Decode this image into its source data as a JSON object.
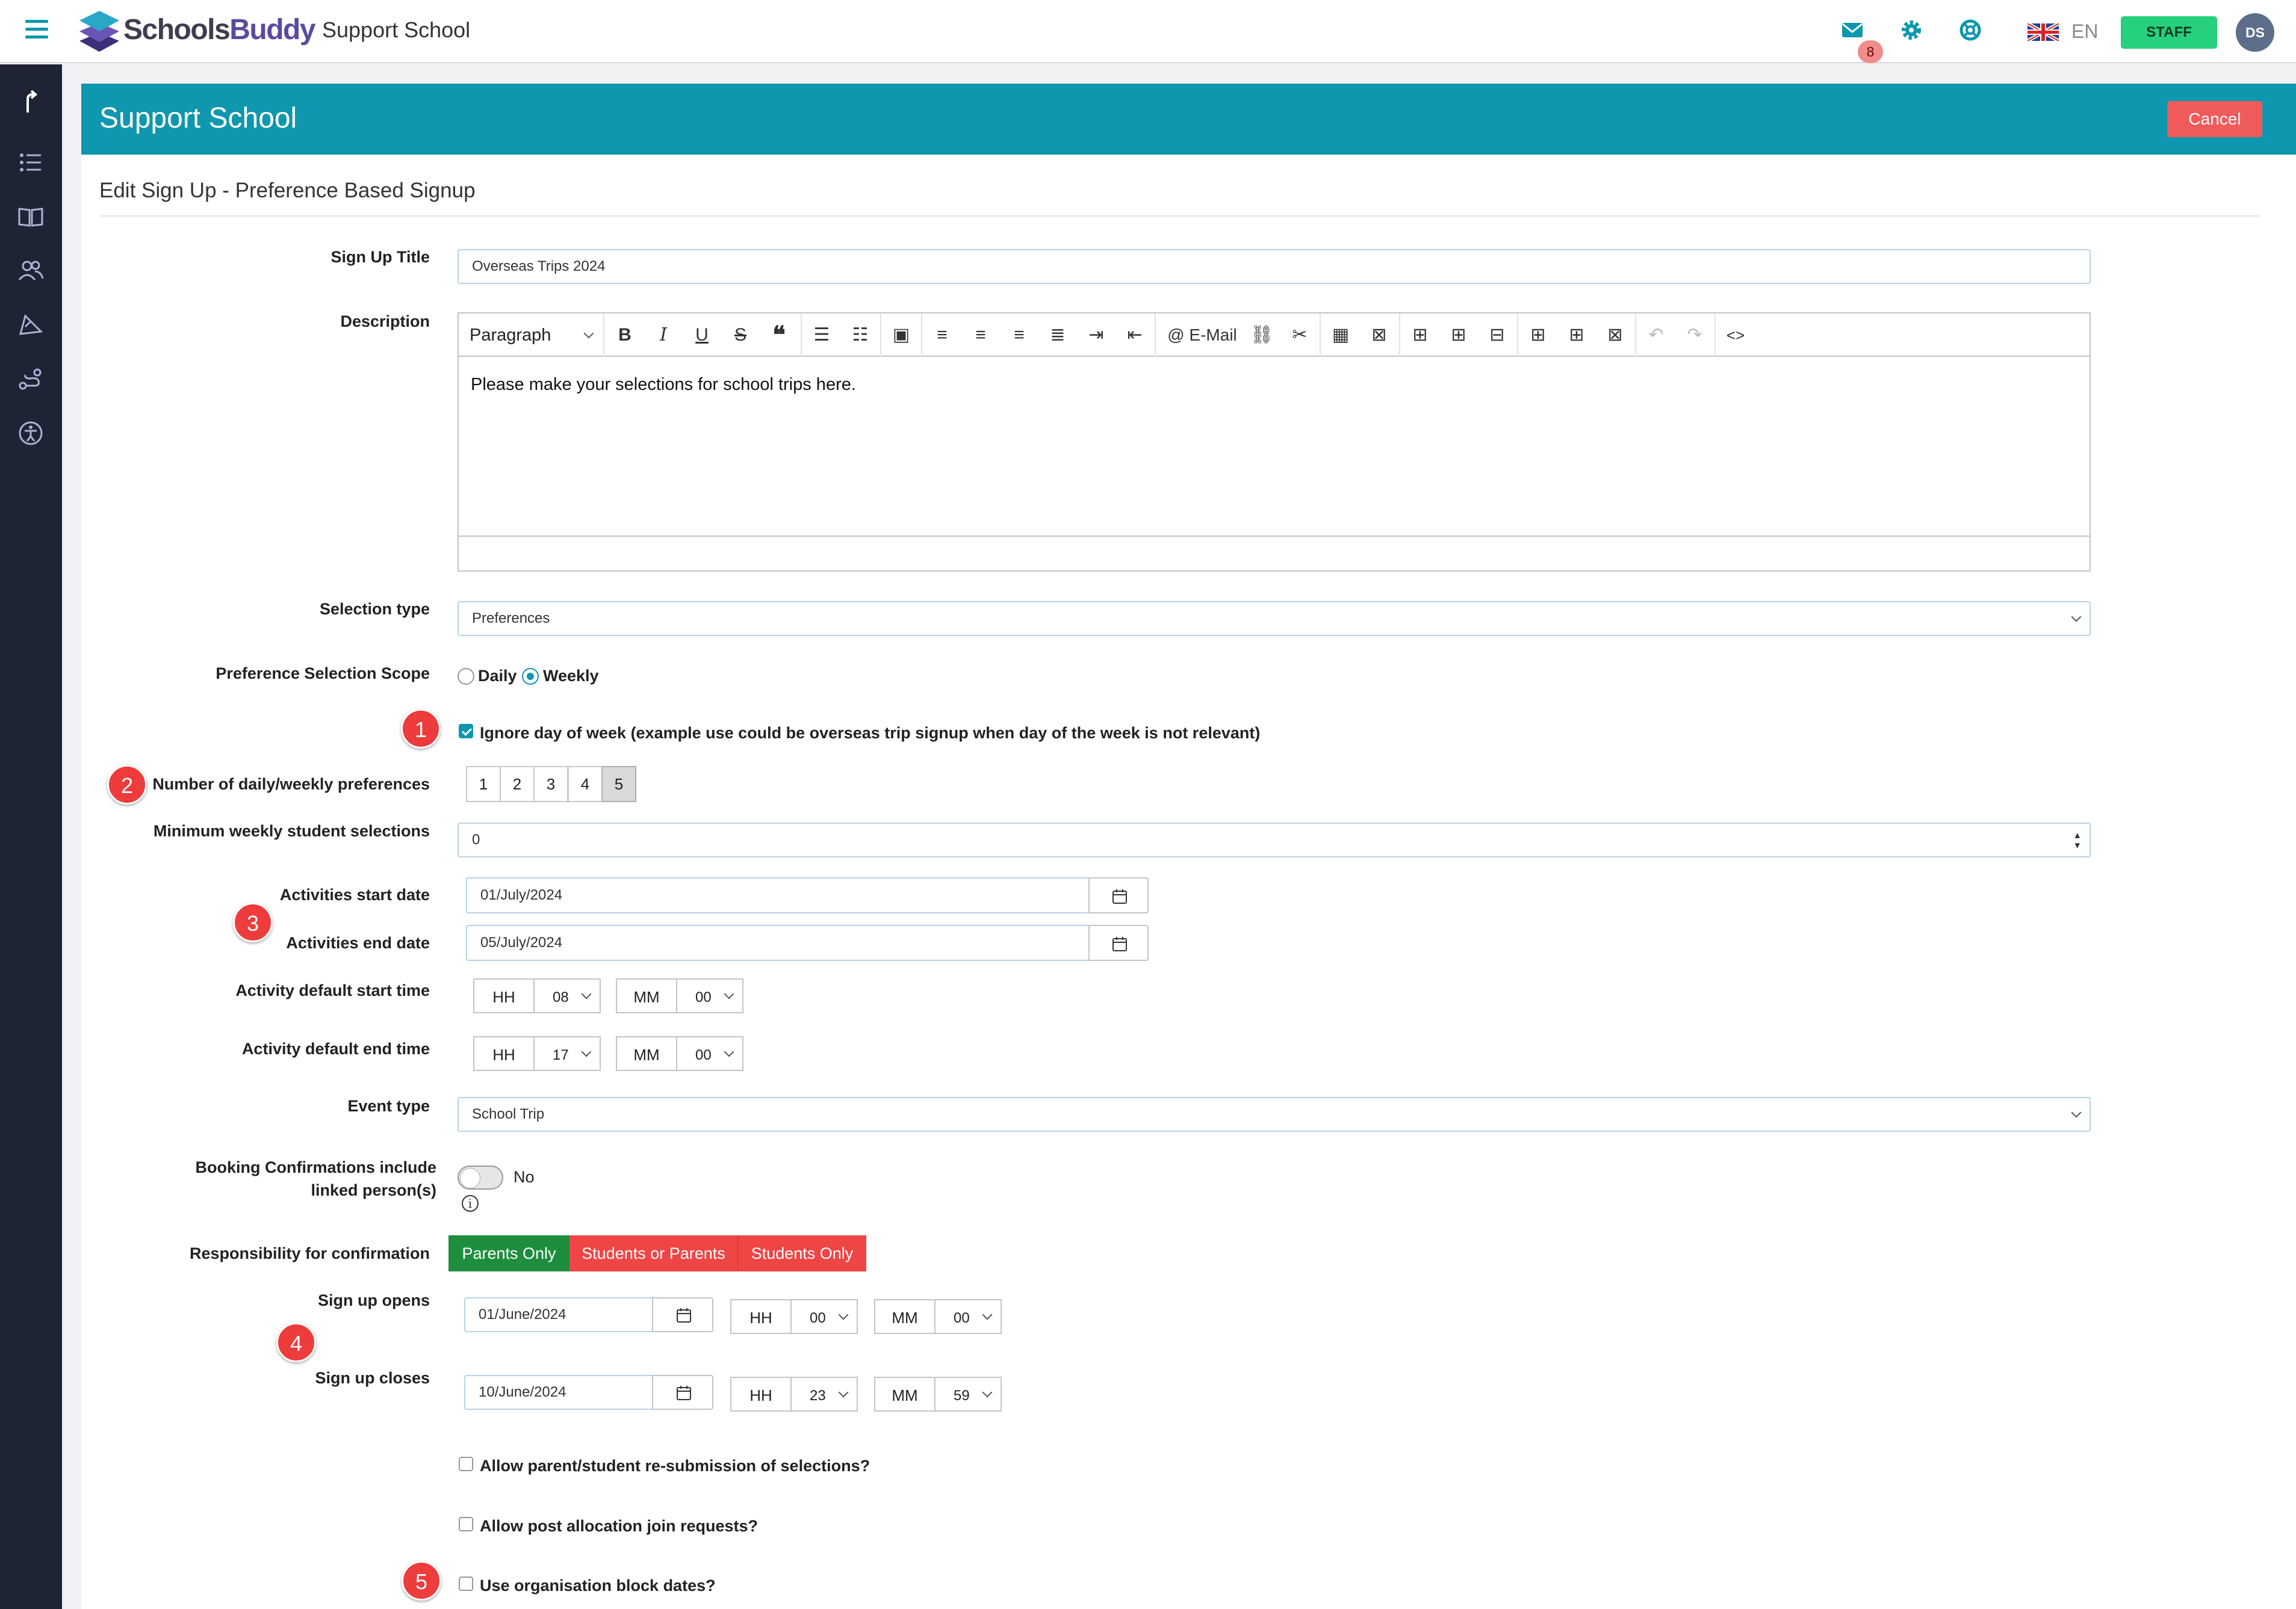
{
  "topbar": {
    "brand_part1": "Schools",
    "brand_part2": "Buddy",
    "school_name": "Support School",
    "mail_count": "8",
    "language": "EN",
    "role": "STAFF",
    "avatar_initials": "DS"
  },
  "sidebar": {
    "icons": [
      "go-up-icon",
      "list-icon",
      "book-icon",
      "users-icon",
      "megaphone-icon",
      "route-icon",
      "accessibility-icon"
    ]
  },
  "header": {
    "title": "Support School",
    "cancel": "Cancel"
  },
  "page": {
    "subtitle": "Edit Sign Up - Preference Based Signup"
  },
  "form": {
    "sign_up_title": {
      "label": "Sign Up Title",
      "value": "Overseas Trips 2024"
    },
    "description": {
      "label": "Description",
      "paragraph": "Paragraph",
      "email": "E-Mail",
      "content": "Please make your selections for school trips here."
    },
    "selection_type": {
      "label": "Selection type",
      "value": "Preferences"
    },
    "preference_scope": {
      "label": "Preference Selection Scope",
      "options": [
        "Daily",
        "Weekly"
      ],
      "selected": "Weekly"
    },
    "ignore_day": {
      "label": "Ignore day of week (example use could be overseas trip signup when day of the week is not relevant)",
      "checked": true
    },
    "num_preferences": {
      "label": "Number of daily/weekly preferences",
      "options": [
        "1",
        "2",
        "3",
        "4",
        "5"
      ],
      "selected": "5"
    },
    "min_weekly": {
      "label": "Minimum weekly student selections",
      "value": "0"
    },
    "activities_start": {
      "label": "Activities start date",
      "value": "01/July/2024"
    },
    "activities_end": {
      "label": "Activities end date",
      "value": "05/July/2024"
    },
    "default_start_time": {
      "label": "Activity default start time",
      "hh_label": "HH",
      "hh": "08",
      "mm_label": "MM",
      "mm": "00"
    },
    "default_end_time": {
      "label": "Activity default end time",
      "hh_label": "HH",
      "hh": "17",
      "mm_label": "MM",
      "mm": "00"
    },
    "event_type": {
      "label": "Event type",
      "value": "School Trip"
    },
    "booking_confirmations": {
      "label": "Booking Confirmations include linked person(s)",
      "value": "No"
    },
    "responsibility": {
      "label": "Responsibility for confirmation",
      "options": [
        "Parents Only",
        "Students or Parents",
        "Students Only"
      ],
      "selected": "Parents Only"
    },
    "signup_opens": {
      "label": "Sign up opens",
      "date": "01/June/2024",
      "hh_label": "HH",
      "hh": "00",
      "mm_label": "MM",
      "mm": "00"
    },
    "signup_closes": {
      "label": "Sign up closes",
      "date": "10/June/2024",
      "hh_label": "HH",
      "hh": "23",
      "mm_label": "MM",
      "mm": "59"
    },
    "allow_resubmission": {
      "label": "Allow parent/student re-submission of selections?",
      "checked": false
    },
    "allow_post_allocation": {
      "label": "Allow post allocation join requests?",
      "checked": false
    },
    "use_block_dates": {
      "label": "Use organisation block dates?",
      "checked": false
    }
  },
  "markers": [
    "1",
    "2",
    "3",
    "4",
    "5"
  ],
  "colors": {
    "brand": "#0e97ae",
    "cancel": "#f15a5a",
    "staff": "#26d07c",
    "parents_only": "#1e8e3e",
    "unselected_segment": "#f04545",
    "sidebar": "#1e2434",
    "marker": "#ee3b3b"
  }
}
